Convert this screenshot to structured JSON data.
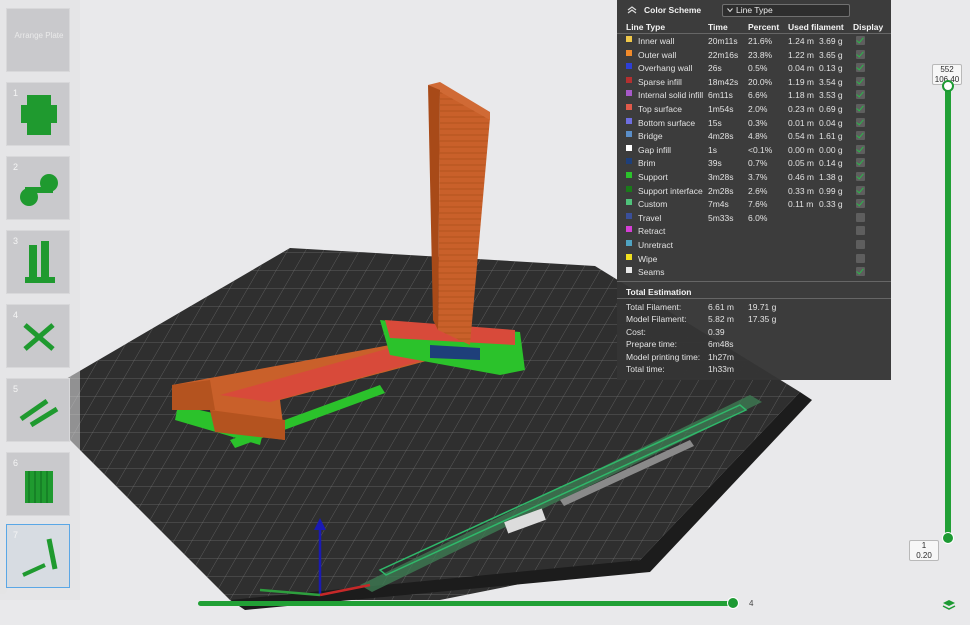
{
  "plates": [
    {
      "number": "",
      "label": "Arrange\nPlate",
      "icon": "empty-plate"
    },
    {
      "number": "1",
      "icon": "plate-1-thumbnail"
    },
    {
      "number": "2",
      "icon": "plate-2-thumbnail"
    },
    {
      "number": "3",
      "icon": "plate-3-thumbnail"
    },
    {
      "number": "4",
      "icon": "plate-4-thumbnail"
    },
    {
      "number": "5",
      "icon": "plate-5-thumbnail"
    },
    {
      "number": "6",
      "icon": "plate-6-thumbnail"
    },
    {
      "number": "7",
      "icon": "plate-7-thumbnail",
      "selected": true
    }
  ],
  "legend": {
    "scheme_label": "Color Scheme",
    "scheme_value": "Line Type",
    "columns": {
      "type": "Line Type",
      "time": "Time",
      "percent": "Percent",
      "filament": "Used filament",
      "display": "Display"
    },
    "rows": [
      {
        "name": "Inner wall",
        "color": "#f0c84a",
        "time": "20m11s",
        "percent": "21.6%",
        "len": "1.24 m",
        "weight": "3.69 g",
        "display": true
      },
      {
        "name": "Outer wall",
        "color": "#f08a2a",
        "time": "22m16s",
        "percent": "23.8%",
        "len": "1.22 m",
        "weight": "3.65 g",
        "display": true
      },
      {
        "name": "Overhang wall",
        "color": "#2d3fd6",
        "time": "26s",
        "percent": "0.5%",
        "len": "0.04 m",
        "weight": "0.13 g",
        "display": true
      },
      {
        "name": "Sparse infill",
        "color": "#b43030",
        "time": "18m42s",
        "percent": "20.0%",
        "len": "1.19 m",
        "weight": "3.54 g",
        "display": true
      },
      {
        "name": "Internal solid infill",
        "color": "#a659c9",
        "time": "6m11s",
        "percent": "6.6%",
        "len": "1.18 m",
        "weight": "3.53 g",
        "display": true
      },
      {
        "name": "Top surface",
        "color": "#e05a4a",
        "time": "1m54s",
        "percent": "2.0%",
        "len": "0.23 m",
        "weight": "0.69 g",
        "display": true
      },
      {
        "name": "Bottom surface",
        "color": "#6e6ee0",
        "time": "15s",
        "percent": "0.3%",
        "len": "0.01 m",
        "weight": "0.04 g",
        "display": true
      },
      {
        "name": "Bridge",
        "color": "#5a8ec8",
        "time": "4m28s",
        "percent": "4.8%",
        "len": "0.54 m",
        "weight": "1.61 g",
        "display": true
      },
      {
        "name": "Gap infill",
        "color": "#ffffff",
        "time": "1s",
        "percent": "<0.1%",
        "len": "0.00 m",
        "weight": "0.00 g",
        "display": true
      },
      {
        "name": "Brim",
        "color": "#1e3f7a",
        "time": "39s",
        "percent": "0.7%",
        "len": "0.05 m",
        "weight": "0.14 g",
        "display": true
      },
      {
        "name": "Support",
        "color": "#2bc22b",
        "time": "3m28s",
        "percent": "3.7%",
        "len": "0.46 m",
        "weight": "1.38 g",
        "display": true
      },
      {
        "name": "Support interface",
        "color": "#1a7a1a",
        "time": "2m28s",
        "percent": "2.6%",
        "len": "0.33 m",
        "weight": "0.99 g",
        "display": true
      },
      {
        "name": "Custom",
        "color": "#4fc27a",
        "time": "7m4s",
        "percent": "7.6%",
        "len": "0.11 m",
        "weight": "0.33 g",
        "display": true
      },
      {
        "name": "Travel",
        "color": "#3a4f9a",
        "time": "5m33s",
        "percent": "6.0%",
        "len": "",
        "weight": "",
        "display": false
      },
      {
        "name": "Retract",
        "color": "#d63fd6",
        "time": "",
        "percent": "",
        "len": "",
        "weight": "",
        "display": false
      },
      {
        "name": "Unretract",
        "color": "#4fa3c2",
        "time": "",
        "percent": "",
        "len": "",
        "weight": "",
        "display": false
      },
      {
        "name": "Wipe",
        "color": "#f0e020",
        "time": "",
        "percent": "",
        "len": "",
        "weight": "",
        "display": false
      },
      {
        "name": "Seams",
        "color": "#e8e8e8",
        "time": "",
        "percent": "",
        "len": "",
        "weight": "",
        "display": true
      }
    ],
    "total_title": "Total Estimation",
    "totals": [
      {
        "label": "Total Filament:",
        "v1": "6.61 m",
        "v2": "19.71 g"
      },
      {
        "label": "Model Filament:",
        "v1": "5.82 m",
        "v2": "17.35 g"
      },
      {
        "label": "Cost:",
        "v1": "0.39",
        "v2": ""
      },
      {
        "label": "Prepare time:",
        "v1": "6m48s",
        "v2": ""
      },
      {
        "label": "Model printing time:",
        "v1": "1h27m",
        "v2": ""
      },
      {
        "label": "Total time:",
        "v1": "1h33m",
        "v2": ""
      }
    ]
  },
  "layer_slider": {
    "top_layer": "552",
    "top_height": "106.40",
    "bottom_layer": "1",
    "bottom_height": "0.20"
  },
  "move_slider": {
    "value": "4"
  },
  "colors": {
    "accent": "#21a035",
    "panel": "#343434",
    "bed": "#3a3a3a",
    "model": "#c9602a"
  }
}
